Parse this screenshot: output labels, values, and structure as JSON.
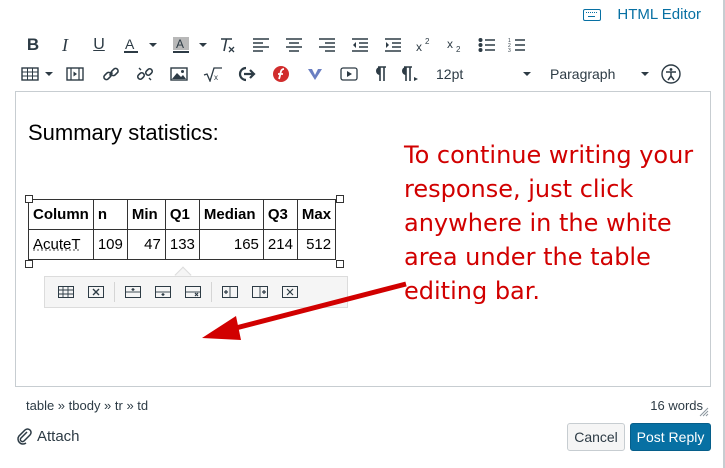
{
  "header": {
    "html_editor_label": "HTML Editor"
  },
  "toolbar": {
    "font_size": "12pt",
    "block_format": "Paragraph"
  },
  "content": {
    "heading": "Summary statistics:",
    "table": {
      "columns": [
        "Column",
        "n",
        "Min",
        "Q1",
        "Median",
        "Q3",
        "Max"
      ],
      "rows": [
        [
          "AcuteT",
          "109",
          "47",
          "133",
          "165",
          "214",
          "512"
        ]
      ]
    }
  },
  "annotation": {
    "text": "To continue writing your response, just click anywhere in the white area under the table editing bar.",
    "color": "#d10000"
  },
  "status": {
    "path": "table » tbody » tr » td",
    "word_count": "16 words"
  },
  "footer": {
    "attach_label": "Attach",
    "cancel_label": "Cancel",
    "post_label": "Post Reply"
  },
  "colors": {
    "accent": "#0770a3",
    "annotation": "#d10000"
  }
}
